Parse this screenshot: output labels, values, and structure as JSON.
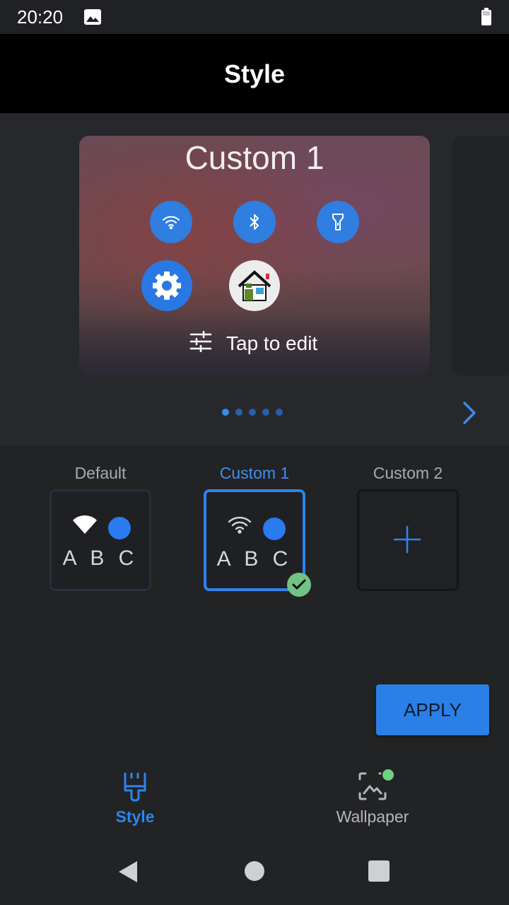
{
  "status_bar": {
    "time": "20:20",
    "icons": [
      "image-icon",
      "battery-icon"
    ]
  },
  "app_bar": {
    "title": "Style"
  },
  "preview": {
    "card_title": "Custom 1",
    "quick_settings_icons": [
      "wifi-icon",
      "bluetooth-icon",
      "flashlight-icon"
    ],
    "app_icons": [
      "settings-app-icon",
      "home-app-icon"
    ],
    "edit_label": "Tap to edit",
    "page_count": 5,
    "active_page": 1
  },
  "style_options": [
    {
      "label": "Default",
      "sample_text": "A B C",
      "selected": false
    },
    {
      "label": "Custom 1",
      "sample_text": "A B C",
      "selected": true
    },
    {
      "label": "Custom 2",
      "selected": false
    }
  ],
  "apply_button": {
    "label": "APPLY"
  },
  "bottom_nav": {
    "items": [
      {
        "label": "Style",
        "icon": "paintbrush-icon",
        "active": true
      },
      {
        "label": "Wallpaper",
        "icon": "wallpaper-icon",
        "active": false
      }
    ]
  },
  "colors": {
    "accent": "#2e83f0",
    "check": "#72c283",
    "notification": "#6ad37f"
  }
}
